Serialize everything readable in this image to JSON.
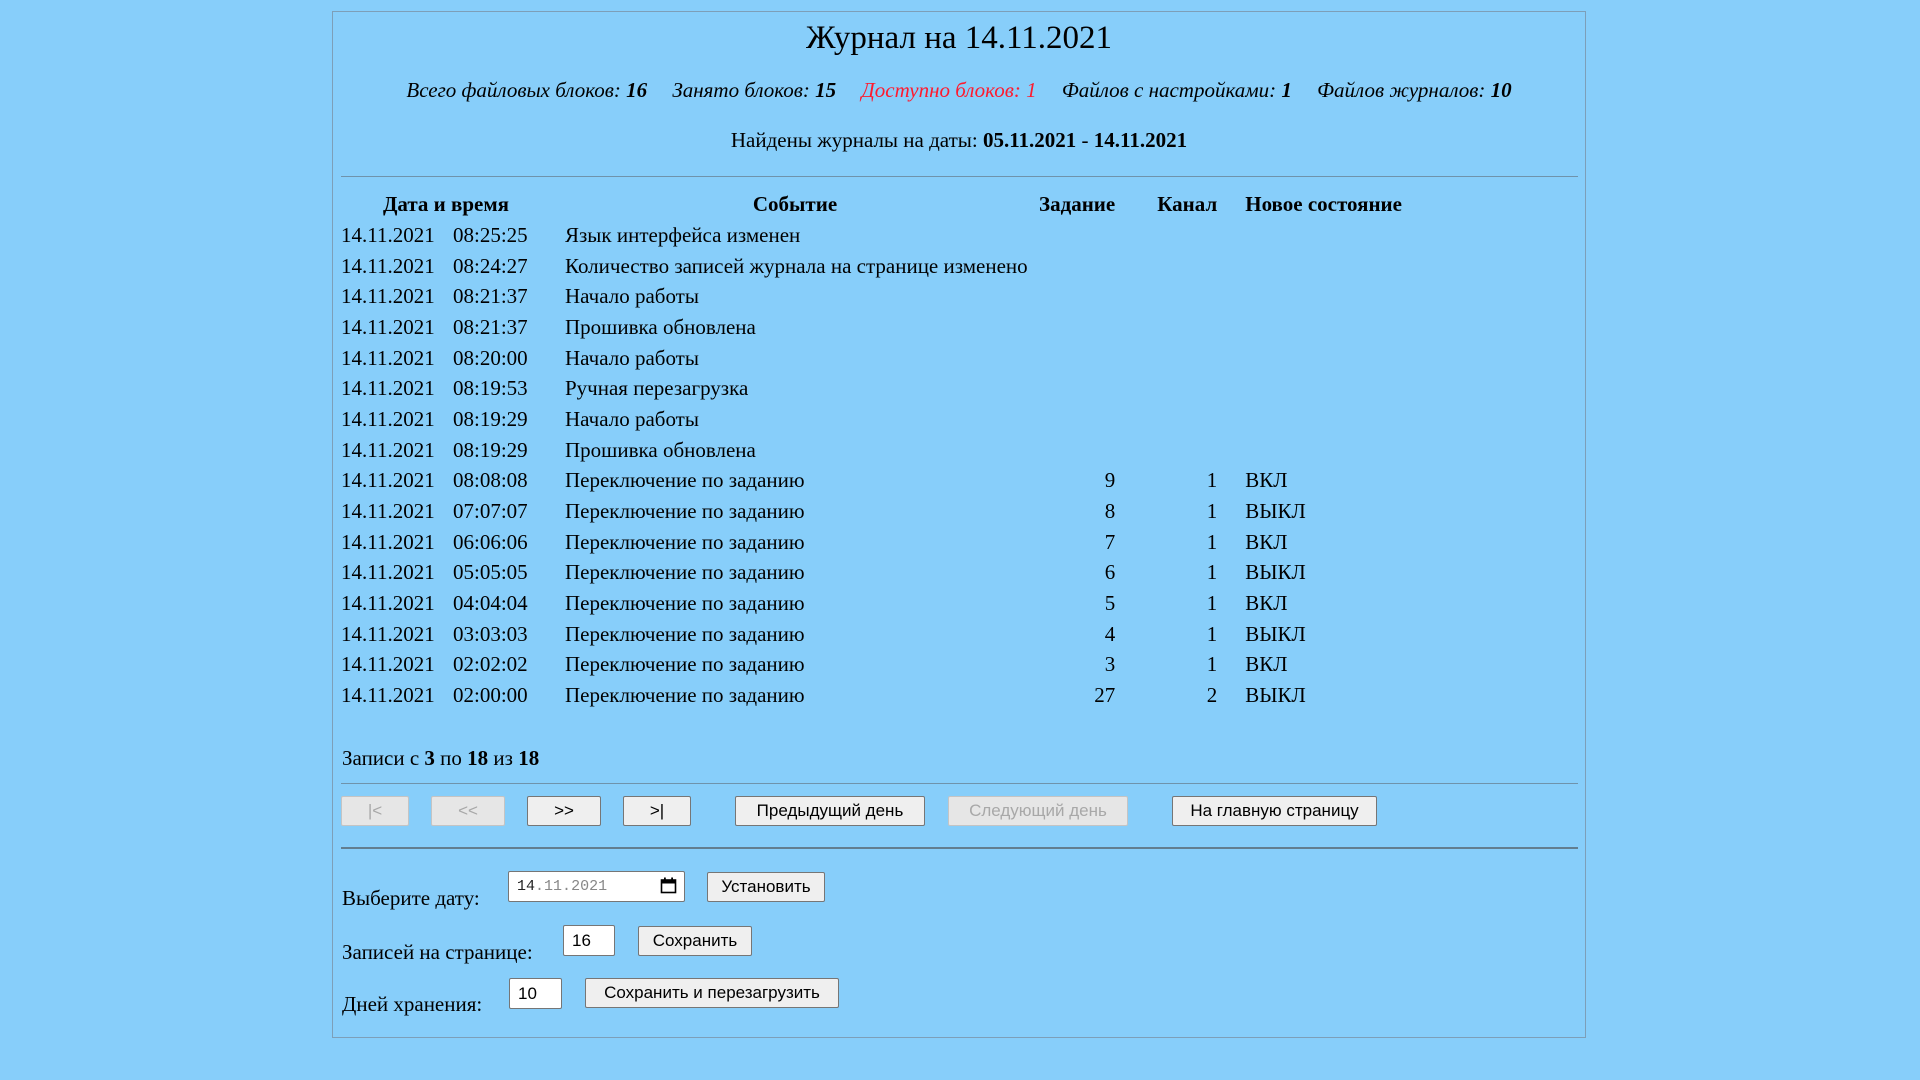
{
  "header": {
    "title": "Журнал на 14.11.2021"
  },
  "stats": {
    "total_label": "Всего файловых блоков:",
    "total_value": "16",
    "used_label": "Занято блоков:",
    "used_value": "15",
    "free_label": "Доступно блоков:",
    "free_value": "1",
    "settings_label": "Файлов с настройками:",
    "settings_value": "1",
    "logs_label": "Файлов журналов:",
    "logs_value": "10",
    "alert_color": "#ff1a2e"
  },
  "found": {
    "label": "Найдены журналы на даты:",
    "from": "05.11.2021",
    "sep": "-",
    "to": "14.11.2021"
  },
  "table": {
    "headers": {
      "datetime": "Дата и время",
      "event": "Событие",
      "task": "Задание",
      "channel": "Канал",
      "state": "Новое состояние"
    },
    "rows": [
      {
        "date": "14.11.2021",
        "time": "08:25:25",
        "event": "Язык интерфейса изменен",
        "task": "",
        "channel": "",
        "state": ""
      },
      {
        "date": "14.11.2021",
        "time": "08:24:27",
        "event": "Количество записей журнала на странице изменено",
        "task": "",
        "channel": "",
        "state": ""
      },
      {
        "date": "14.11.2021",
        "time": "08:21:37",
        "event": "Начало работы",
        "task": "",
        "channel": "",
        "state": ""
      },
      {
        "date": "14.11.2021",
        "time": "08:21:37",
        "event": "Прошивка обновлена",
        "task": "",
        "channel": "",
        "state": ""
      },
      {
        "date": "14.11.2021",
        "time": "08:20:00",
        "event": "Начало работы",
        "task": "",
        "channel": "",
        "state": ""
      },
      {
        "date": "14.11.2021",
        "time": "08:19:53",
        "event": "Ручная перезагрузка",
        "task": "",
        "channel": "",
        "state": ""
      },
      {
        "date": "14.11.2021",
        "time": "08:19:29",
        "event": "Начало работы",
        "task": "",
        "channel": "",
        "state": ""
      },
      {
        "date": "14.11.2021",
        "time": "08:19:29",
        "event": "Прошивка обновлена",
        "task": "",
        "channel": "",
        "state": ""
      },
      {
        "date": "14.11.2021",
        "time": "08:08:08",
        "event": "Переключение по заданию",
        "task": "9",
        "channel": "1",
        "state": "ВКЛ"
      },
      {
        "date": "14.11.2021",
        "time": "07:07:07",
        "event": "Переключение по заданию",
        "task": "8",
        "channel": "1",
        "state": "ВЫКЛ"
      },
      {
        "date": "14.11.2021",
        "time": "06:06:06",
        "event": "Переключение по заданию",
        "task": "7",
        "channel": "1",
        "state": "ВКЛ"
      },
      {
        "date": "14.11.2021",
        "time": "05:05:05",
        "event": "Переключение по заданию",
        "task": "6",
        "channel": "1",
        "state": "ВЫКЛ"
      },
      {
        "date": "14.11.2021",
        "time": "04:04:04",
        "event": "Переключение по заданию",
        "task": "5",
        "channel": "1",
        "state": "ВКЛ"
      },
      {
        "date": "14.11.2021",
        "time": "03:03:03",
        "event": "Переключение по заданию",
        "task": "4",
        "channel": "1",
        "state": "ВЫКЛ"
      },
      {
        "date": "14.11.2021",
        "time": "02:02:02",
        "event": "Переключение по заданию",
        "task": "3",
        "channel": "1",
        "state": "ВКЛ"
      },
      {
        "date": "14.11.2021",
        "time": "02:00:00",
        "event": "Переключение по заданию",
        "task": "27",
        "channel": "2",
        "state": "ВЫКЛ"
      }
    ]
  },
  "records": {
    "prefix": "Записи с",
    "from": "3",
    "mid": "по",
    "to": "18",
    "of": "из",
    "total": "18"
  },
  "nav": {
    "first": "|<",
    "prev": "<<",
    "next": ">>",
    "last": ">|",
    "prev_day": "Предыдущий день",
    "next_day": "Следующий день",
    "home": "На главную страницу"
  },
  "settings": {
    "date_label": "Выберите дату:",
    "date_day": "14",
    "date_month": "11",
    "date_year": "2021",
    "set_button": "Установить",
    "per_page_label": "Записей на странице:",
    "per_page_value": "16",
    "save_button": "Сохранить",
    "retention_label": "Дней хранения:",
    "retention_value": "10",
    "save_reboot_button": "Сохранить и перезагрузить"
  }
}
